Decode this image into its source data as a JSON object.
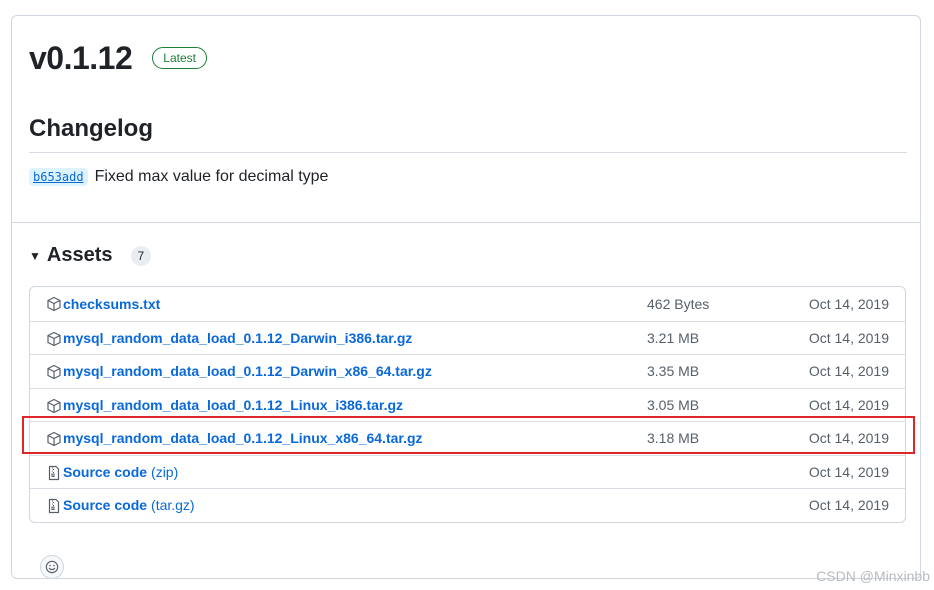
{
  "release": {
    "version": "v0.1.12",
    "badge": "Latest"
  },
  "changelog": {
    "heading": "Changelog",
    "commit_sha": "b653add",
    "commit_message": "Fixed max value for decimal type"
  },
  "assets": {
    "heading": "Assets",
    "count": "7",
    "items": [
      {
        "name": "checksums.txt",
        "ext": "",
        "size": "462 Bytes",
        "date": "Oct 14, 2019",
        "icon": "package-icon"
      },
      {
        "name": "mysql_random_data_load_0.1.12_Darwin_i386.tar.gz",
        "ext": "",
        "size": "3.21 MB",
        "date": "Oct 14, 2019",
        "icon": "package-icon"
      },
      {
        "name": "mysql_random_data_load_0.1.12_Darwin_x86_64.tar.gz",
        "ext": "",
        "size": "3.35 MB",
        "date": "Oct 14, 2019",
        "icon": "package-icon"
      },
      {
        "name": "mysql_random_data_load_0.1.12_Linux_i386.tar.gz",
        "ext": "",
        "size": "3.05 MB",
        "date": "Oct 14, 2019",
        "icon": "package-icon"
      },
      {
        "name": "mysql_random_data_load_0.1.12_Linux_x86_64.tar.gz",
        "ext": "",
        "size": "3.18 MB",
        "date": "Oct 14, 2019",
        "icon": "package-icon"
      },
      {
        "name": "Source code",
        "ext": "(zip)",
        "size": "",
        "date": "Oct 14, 2019",
        "icon": "file-zip-icon"
      },
      {
        "name": "Source code",
        "ext": "(tar.gz)",
        "size": "",
        "date": "Oct 14, 2019",
        "icon": "file-zip-icon"
      }
    ]
  },
  "reaction": {
    "icon": "smiley-icon"
  },
  "watermark": "CSDN @Minxinbb",
  "colors": {
    "accent": "#0969da",
    "latest": "#1a7f37",
    "highlight": "#e0262a"
  }
}
